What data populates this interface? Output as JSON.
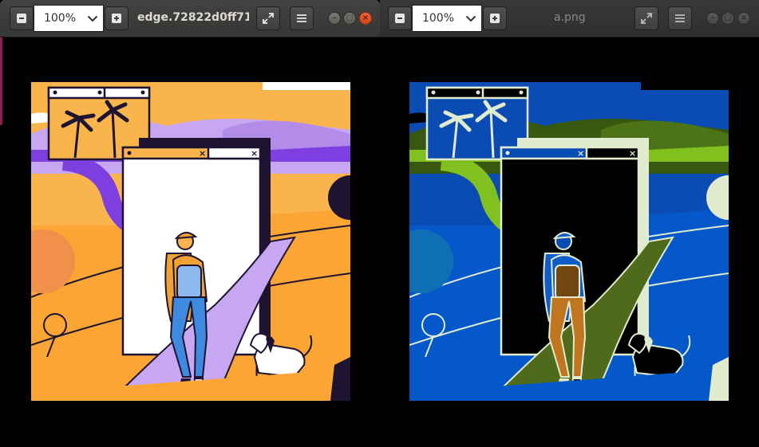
{
  "left_window": {
    "zoom_out_icon": "minus-icon",
    "zoom_value": "100%",
    "zoom_in_icon": "plus-icon",
    "title": "edge.72822d0ff71...",
    "fullscreen_icon": "expand-icon",
    "menu_icon": "hamburger-icon",
    "image": "illustration-original"
  },
  "right_window": {
    "zoom_out_icon": "minus-icon",
    "zoom_value": "100%",
    "zoom_in_icon": "plus-icon",
    "title": "a.png",
    "fullscreen_icon": "expand-icon",
    "menu_icon": "hamburger-icon",
    "image": "illustration-inverted"
  },
  "colors": {
    "titlebar": "#3c3c3b",
    "close_button": "#e9541e",
    "left_sky": "#f9b44c",
    "left_lavender": "#c7a7f2",
    "left_purple": "#7e3ee0",
    "left_dark": "#1e1432",
    "right_sky": "#0a4cb3",
    "right_hill": "#3a6a00",
    "right_path": "#4e6a1a",
    "right_light": "#dcedc6"
  }
}
